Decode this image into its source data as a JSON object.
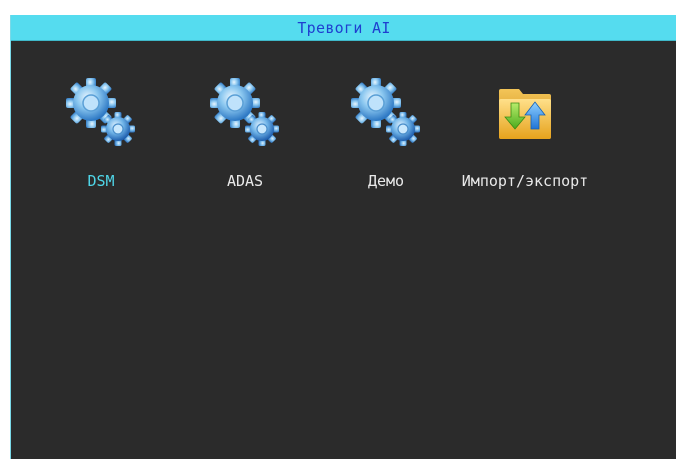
{
  "window": {
    "title": "Тревоги AI",
    "title_color": "#1f3fd0",
    "titlebar_color": "#55dcef",
    "background_color": "#2b2b2b"
  },
  "menu": {
    "selected_index": 0,
    "selected_color": "#4fd6e8",
    "items": [
      {
        "label": "DSM",
        "icon": "gears-icon"
      },
      {
        "label": "ADAS",
        "icon": "gears-icon"
      },
      {
        "label": "Демо",
        "icon": "gears-icon"
      },
      {
        "label": "Импорт/экспорт",
        "icon": "folder-import-export-icon"
      }
    ]
  }
}
